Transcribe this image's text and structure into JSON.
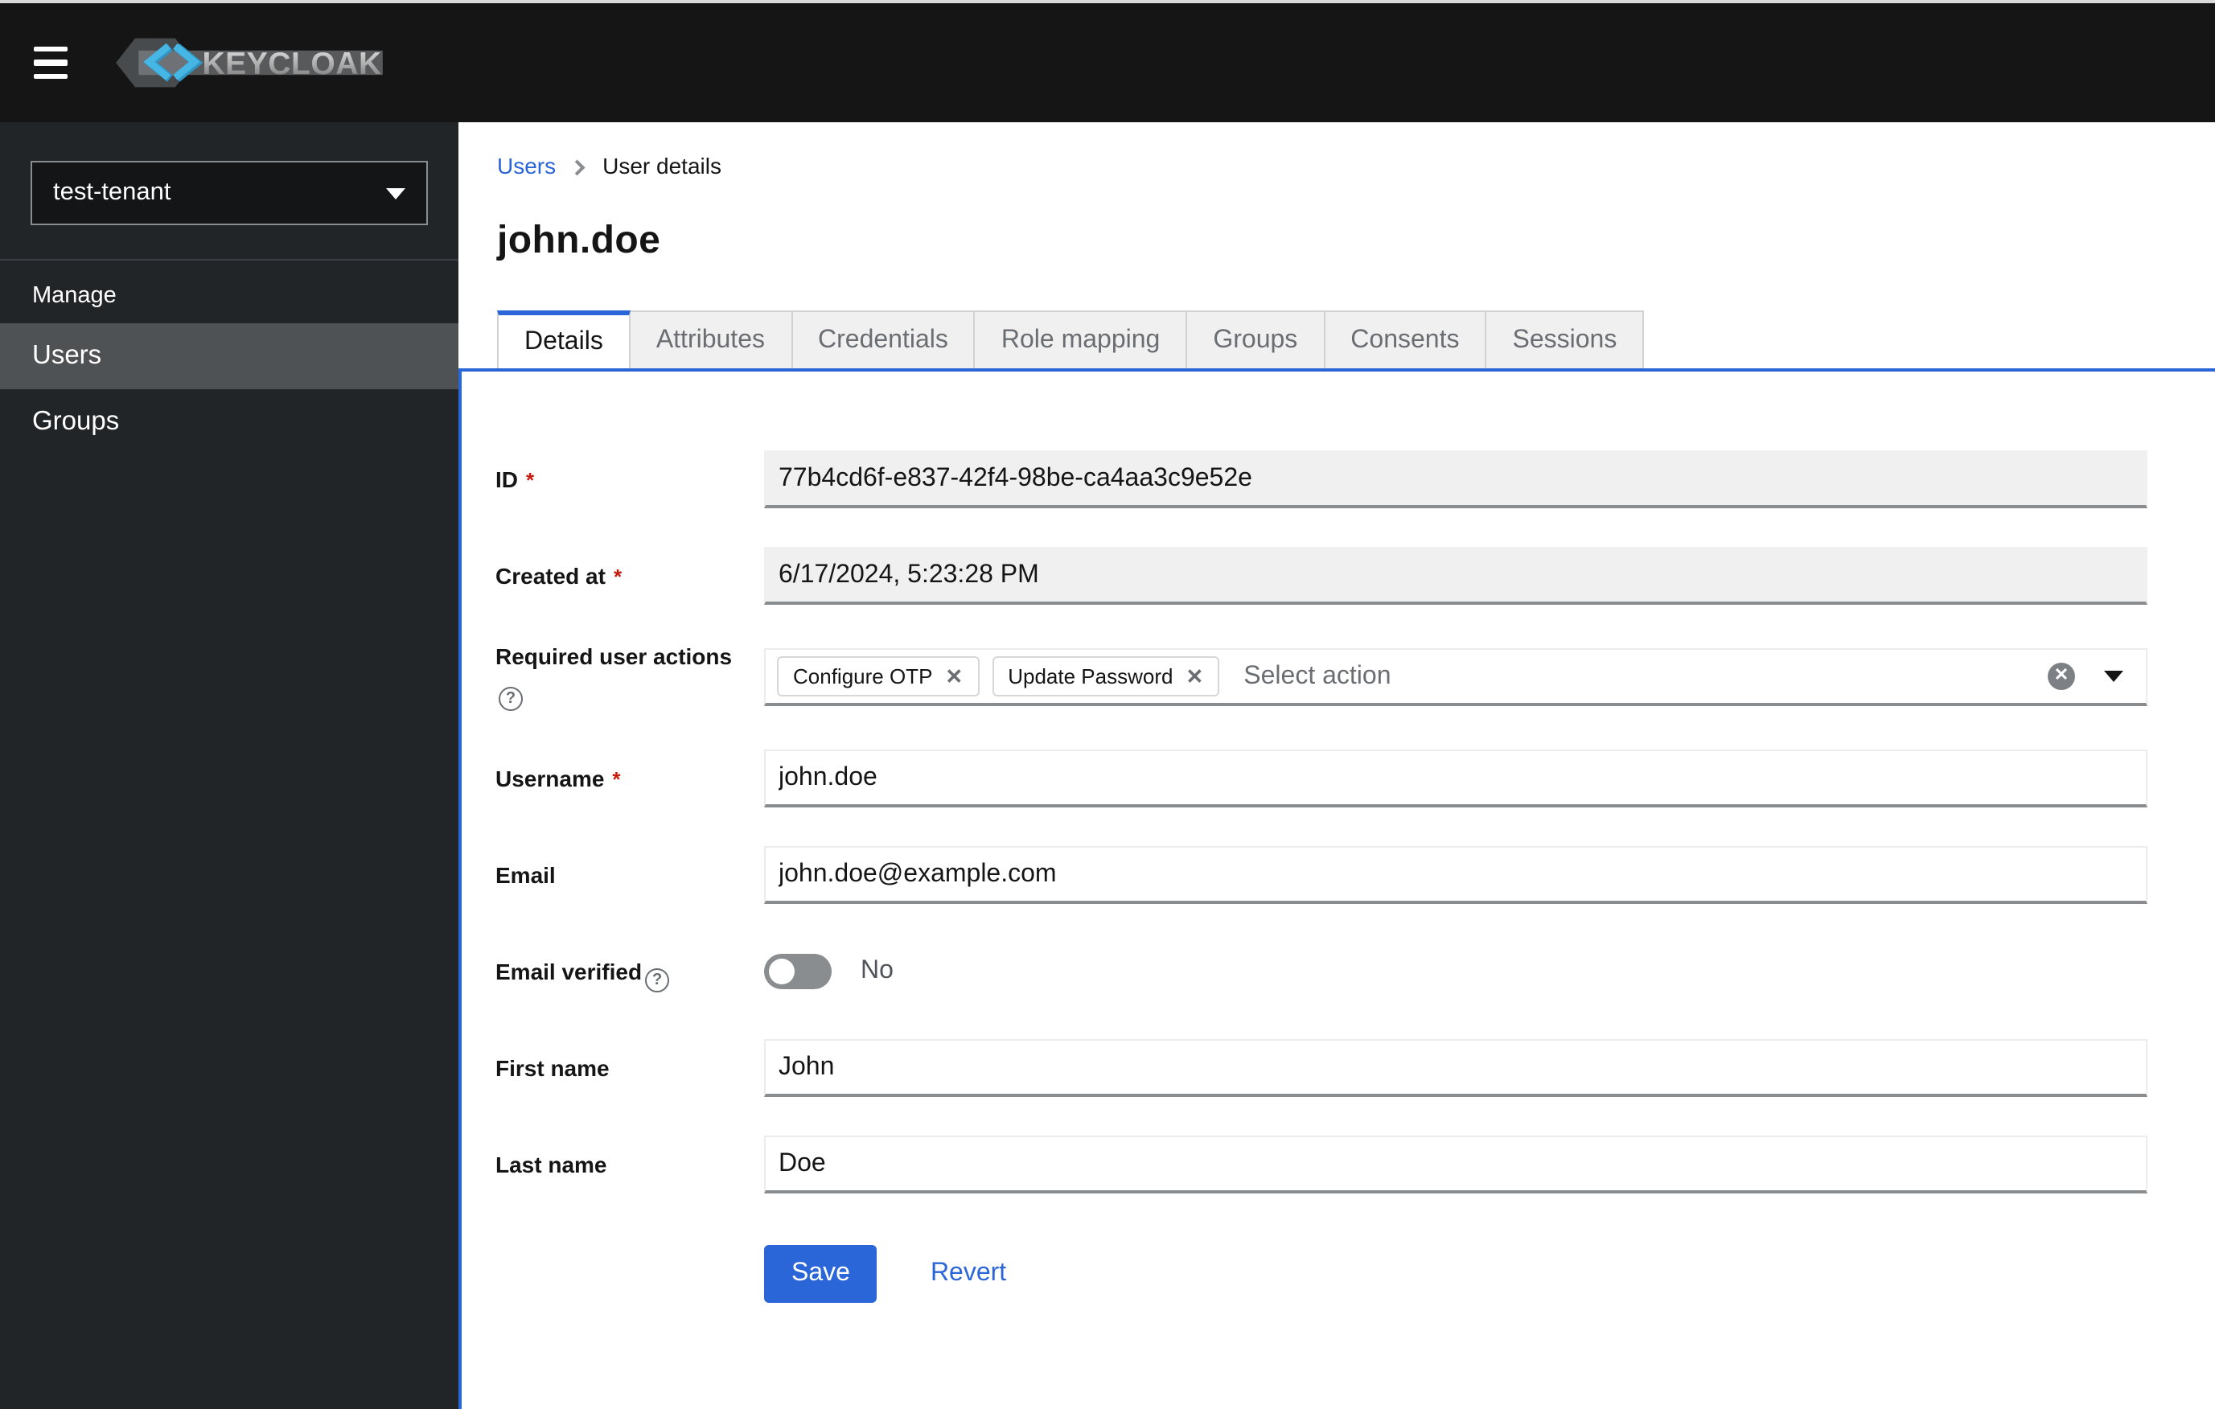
{
  "masthead": {
    "brand_text": "KEYCLOAK",
    "background": "#151515"
  },
  "sidebar": {
    "realm_selector": {
      "value": "test-tenant"
    },
    "section_title": "Manage",
    "items": [
      {
        "label": "Users",
        "active": true
      },
      {
        "label": "Groups",
        "active": false
      }
    ]
  },
  "breadcrumb": {
    "parent": "Users",
    "current": "User details"
  },
  "page_title": "john.doe",
  "tabs": {
    "active": "Details",
    "items": [
      "Details",
      "Attributes",
      "Credentials",
      "Role mapping",
      "Groups",
      "Consents",
      "Sessions"
    ]
  },
  "form": {
    "id": {
      "label": "ID",
      "value": "77b4cd6f-e837-42f4-98be-ca4aa3c9e52e",
      "required": true,
      "disabled": true
    },
    "created_at": {
      "label": "Created at",
      "value": "6/17/2024, 5:23:28 PM",
      "required": true,
      "disabled": true
    },
    "required_user_actions": {
      "label": "Required user actions",
      "chips": [
        "Configure OTP",
        "Update Password"
      ],
      "placeholder": "Select action"
    },
    "username": {
      "label": "Username",
      "value": "john.doe",
      "required": true
    },
    "email": {
      "label": "Email",
      "value": "john.doe@example.com"
    },
    "email_verified": {
      "label": "Email verified",
      "value": "No",
      "enabled": false
    },
    "first_name": {
      "label": "First name",
      "value": "John"
    },
    "last_name": {
      "label": "Last name",
      "value": "Doe"
    },
    "actions": {
      "save": "Save",
      "revert": "Revert"
    }
  },
  "colors": {
    "accent_blue": "#2b66d9",
    "danger_red": "#c9190b",
    "masthead_bg": "#151515",
    "sidebar_bg": "#222528",
    "sidebar_active_bg": "#4f5255",
    "disabled_input_bg": "#f0f0f0",
    "input_bottom_border": "#8a8d90",
    "inactive_tab_bg": "#f0f0f0"
  }
}
